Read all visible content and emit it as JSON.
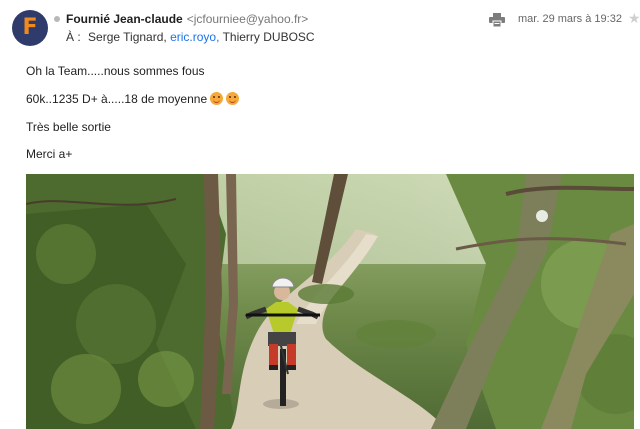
{
  "email": {
    "avatar_letter": "F",
    "sender_name": "Fournié Jean-claude",
    "sender_email": "<jcfourniee@yahoo.fr>",
    "to_label": "À :",
    "recipients": [
      "Serge Tignard,",
      "eric.royo,",
      "Thierry DUBOSC"
    ],
    "date": "mar. 29 mars à 19:32",
    "body": {
      "line1": "Oh la Team.....nous sommes fous",
      "line2": "60k..1235 D+  à.....18 de moyenne",
      "line3": "Très belle sortie",
      "line4": "Merci  a+"
    }
  },
  "icons": {
    "print": "print-icon",
    "star": "star-icon",
    "emoji": "smiling-face-with-heart-eyes"
  },
  "colors": {
    "avatar_bg": "#2f3b6b",
    "avatar_letter": "#f08a1c",
    "link": "#1a73e8"
  }
}
